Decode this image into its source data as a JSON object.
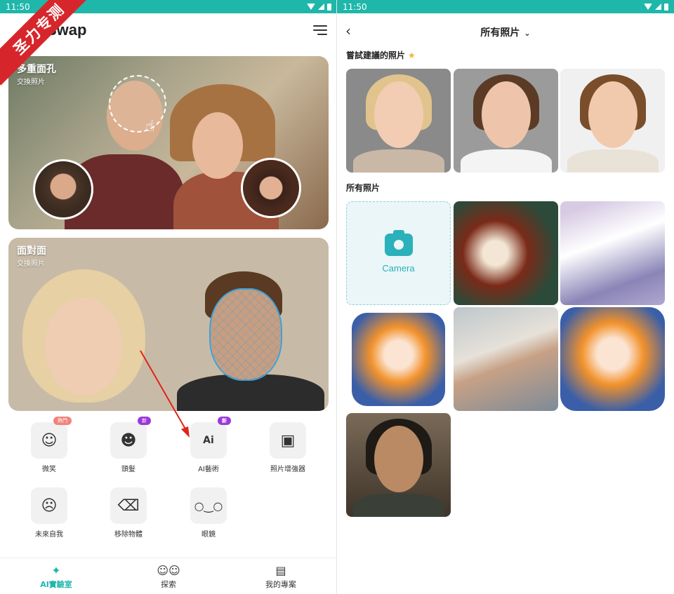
{
  "status": {
    "time_left": "11:50",
    "time_right": "11:50"
  },
  "watermark": "圣力专测",
  "app": {
    "logo_text": "Swap"
  },
  "cards": [
    {
      "title": "多重面孔",
      "subtitle": "交換照片"
    },
    {
      "title": "面對面",
      "subtitle": "交換照片"
    }
  ],
  "tools": [
    {
      "label": "微笑",
      "icon": "face-smile-icon",
      "badge": "熱門"
    },
    {
      "label": "頭髮",
      "icon": "hair-icon",
      "badge": "新"
    },
    {
      "label": "AI藝術",
      "icon": "ai-art-icon",
      "badge": "新"
    },
    {
      "label": "照片增強器",
      "icon": "photo-enhance-icon",
      "badge": ""
    },
    {
      "label": "未來自我",
      "icon": "future-self-icon",
      "badge": ""
    },
    {
      "label": "移除物體",
      "icon": "eraser-icon",
      "badge": ""
    },
    {
      "label": "眼鏡",
      "icon": "glasses-icon",
      "badge": ""
    }
  ],
  "bottom_nav": [
    {
      "label": "AI實驗室",
      "icon": "sparkle-icon",
      "active": true
    },
    {
      "label": "探索",
      "icon": "masks-icon",
      "active": false
    },
    {
      "label": "我的專案",
      "icon": "gallery-icon",
      "active": false
    }
  ],
  "album": {
    "title": "所有照片",
    "suggested_heading": "嘗試建議的照片",
    "all_heading": "所有照片",
    "camera_label": "Camera"
  },
  "colors": {
    "accent": "#1fb7aa",
    "badge_hot": "#f0837a",
    "badge_new": "#9b3ad7",
    "arrow": "#e0241b"
  }
}
